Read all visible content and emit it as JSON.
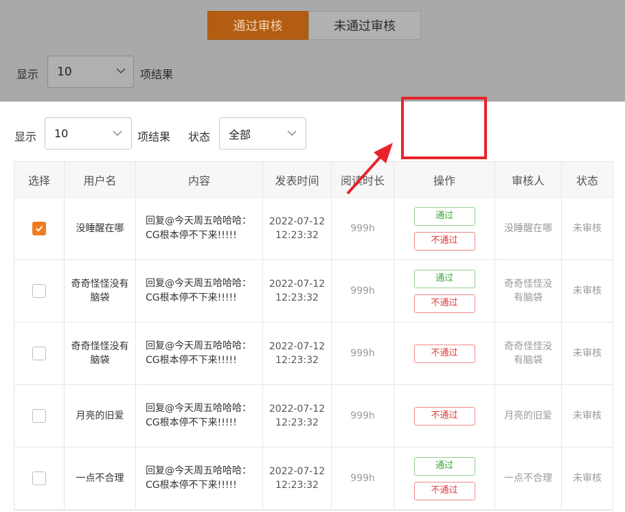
{
  "background": {
    "tabs": [
      {
        "label": "通过审核",
        "active": true
      },
      {
        "label": "未通过审核",
        "active": false
      }
    ],
    "show_label": "显示",
    "page_size": "10",
    "result_label": "项结果"
  },
  "filters": {
    "show_label": "显示",
    "page_size": "10",
    "result_label": "项结果",
    "status_label": "状态",
    "status_value": "全部"
  },
  "table": {
    "headers": [
      "选择",
      "用户名",
      "内容",
      "发表时间",
      "阅读时长",
      "操作",
      "审核人",
      "状态"
    ],
    "rows": [
      {
        "checked": true,
        "username": "没睡醒在哪",
        "content": "回复@今天周五哈哈哈：CG根本停不下来!!!!!",
        "date": "2022-07-12",
        "time": "12:23:32",
        "duration": "999h",
        "pass_label": "通过",
        "fail_label": "不通过",
        "reviewer": "没睡醒在哪",
        "status": "未审核"
      },
      {
        "checked": false,
        "username": "奇奇怪怪没有脑袋",
        "content": "回复@今天周五哈哈哈：CG根本停不下来!!!!!",
        "date": "2022-07-12",
        "time": "12:23:32",
        "duration": "999h",
        "pass_label": "通过",
        "fail_label": "不通过",
        "reviewer": "奇奇怪怪没有脑袋",
        "status": "未审核"
      },
      {
        "checked": false,
        "username": "奇奇怪怪没有脑袋",
        "content": "回复@今天周五哈哈哈：CG根本停不下来!!!!!",
        "date": "2022-07-12",
        "time": "12:23:32",
        "duration": "999h",
        "fail_label": "不通过",
        "reviewer": "奇奇怪怪没有脑袋",
        "status": "未审核"
      },
      {
        "checked": false,
        "username": "月亮的旧爱",
        "content": "回复@今天周五哈哈哈：CG根本停不下来!!!!!",
        "date": "2022-07-12",
        "time": "12:23:32",
        "duration": "999h",
        "fail_label": "不通过",
        "reviewer": "月亮的旧爱",
        "status": "未审核"
      },
      {
        "checked": false,
        "username": "一点不合理",
        "content": "回复@今天周五哈哈哈：CG根本停不下来!!!!!",
        "date": "2022-07-12",
        "time": "12:23:32",
        "duration": "999h",
        "pass_label": "通过",
        "fail_label": "不通过",
        "reviewer": "一点不合理",
        "status": "未审核"
      }
    ]
  },
  "colors": {
    "accent": "#f07c22",
    "pass": "#3aa83a",
    "fail": "#e03a3a",
    "highlight": "#e8222b"
  }
}
